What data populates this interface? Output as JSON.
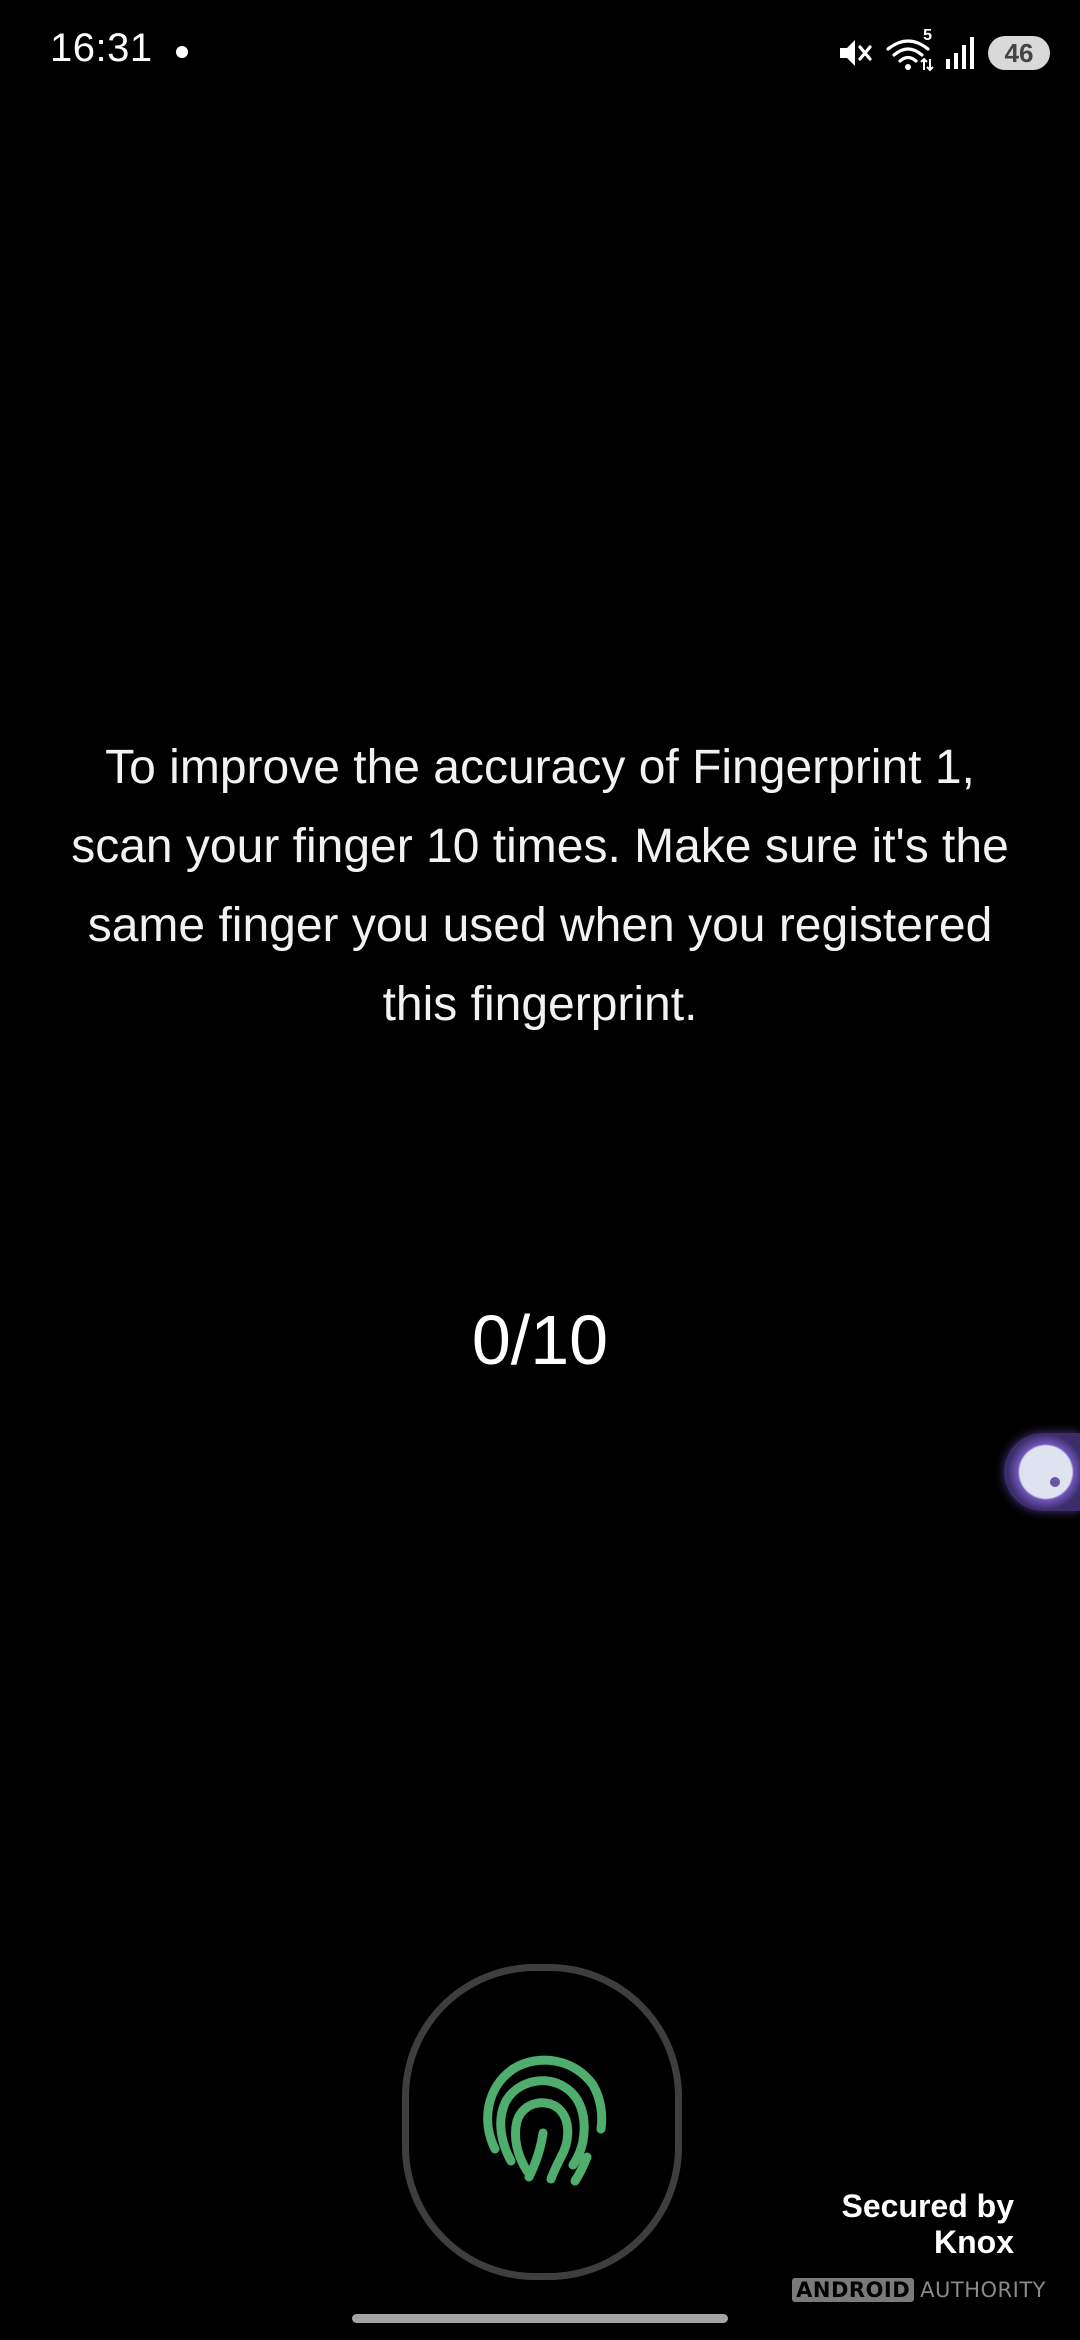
{
  "status_bar": {
    "time": "16:31",
    "icons": [
      "mute-icon",
      "wifi-icon",
      "signal-icon"
    ],
    "wifi_badge": "5",
    "battery": "46"
  },
  "main": {
    "instruction": "To improve the accuracy of Fingerprint 1, scan your finger 10 times. Make sure it's the same finger you used when you registered this fingerprint.",
    "progress": "0/10"
  },
  "sensor": {
    "icon": "fingerprint-icon",
    "color": "#4fae6e"
  },
  "footer": {
    "knox_line1": "Secured by",
    "knox_line2": "Knox"
  },
  "watermark": {
    "brand": "ANDROID",
    "suffix": "AUTHORITY"
  }
}
